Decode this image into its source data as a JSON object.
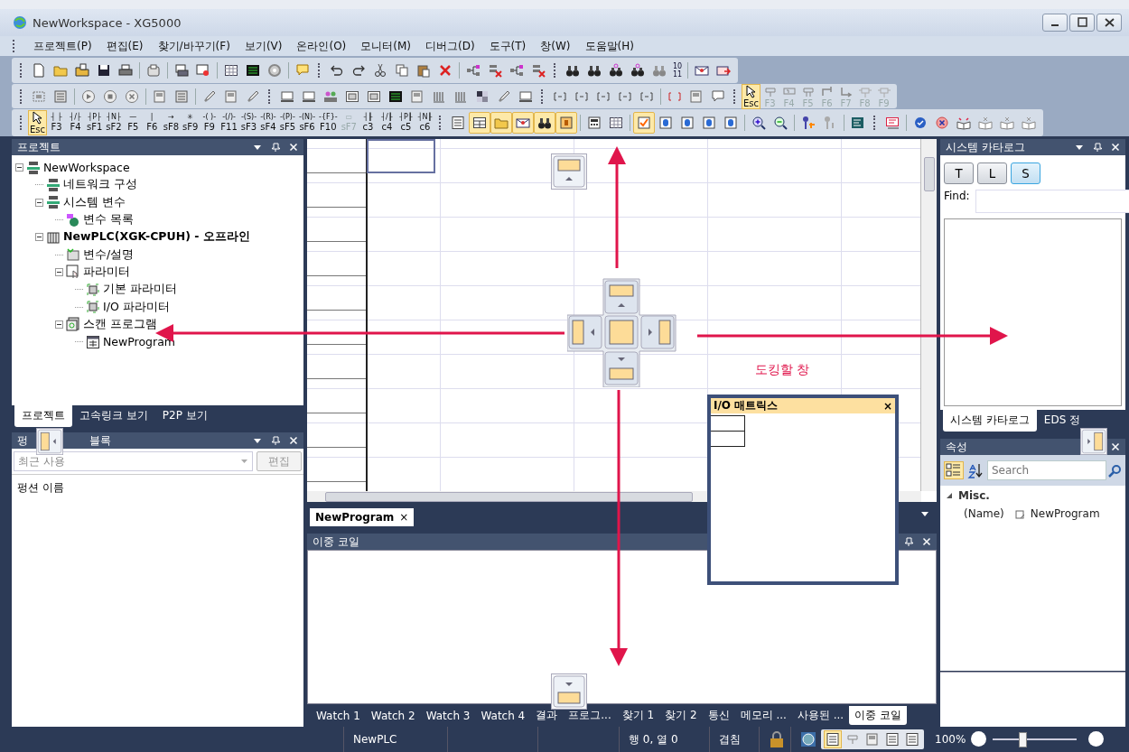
{
  "window": {
    "title": "NewWorkspace - XG5000"
  },
  "menu": [
    "프로젝트(P)",
    "편집(E)",
    "찾기/바꾸기(F)",
    "보기(V)",
    "온라인(O)",
    "모니터(M)",
    "디버그(D)",
    "도구(T)",
    "창(W)",
    "도움말(H)"
  ],
  "toolbar": {
    "replace_numbers": [
      "10",
      "11"
    ],
    "ladder_tools": [
      {
        "key": "Esc",
        "selected": true,
        "disabled": false
      },
      {
        "key": "F3",
        "selected": false,
        "disabled": true
      },
      {
        "key": "F4",
        "selected": false,
        "disabled": true
      },
      {
        "key": "F5",
        "selected": false,
        "disabled": true
      },
      {
        "key": "F6",
        "selected": false,
        "disabled": true
      },
      {
        "key": "F7",
        "selected": false,
        "disabled": true
      },
      {
        "key": "F8",
        "selected": false,
        "disabled": true
      },
      {
        "key": "F9",
        "selected": false,
        "disabled": true
      }
    ],
    "ladder_keys": [
      {
        "key": "Esc",
        "selected": true,
        "disabled": false
      },
      {
        "symbol": "┤ ├",
        "key": "F3",
        "selected": false,
        "disabled": false
      },
      {
        "symbol": "┤/├",
        "key": "F4",
        "selected": false,
        "disabled": false
      },
      {
        "symbol": "┤P├",
        "key": "sF1",
        "selected": false,
        "disabled": false
      },
      {
        "symbol": "┤N├",
        "key": "sF2",
        "selected": false,
        "disabled": false
      },
      {
        "symbol": "—",
        "key": "F5",
        "selected": false,
        "disabled": false
      },
      {
        "symbol": "|",
        "key": "F6",
        "selected": false,
        "disabled": false
      },
      {
        "symbol": "→",
        "key": "sF8",
        "selected": false,
        "disabled": false
      },
      {
        "symbol": "✳",
        "key": "sF9",
        "selected": false,
        "disabled": false
      },
      {
        "symbol": "-( )-",
        "key": "F9",
        "selected": false,
        "disabled": false
      },
      {
        "symbol": "-(/)-",
        "key": "F11",
        "selected": false,
        "disabled": false
      },
      {
        "symbol": "-(S)-",
        "key": "sF3",
        "selected": false,
        "disabled": false
      },
      {
        "symbol": "-(R)-",
        "key": "sF4",
        "selected": false,
        "disabled": false
      },
      {
        "symbol": "-(P)-",
        "key": "sF5",
        "selected": false,
        "disabled": false
      },
      {
        "symbol": "-(N)-",
        "key": "sF6",
        "selected": false,
        "disabled": false
      },
      {
        "symbol": "-{F}-",
        "key": "F10",
        "selected": false,
        "disabled": false
      },
      {
        "symbol": "▭",
        "key": "sF7",
        "selected": false,
        "disabled": true
      },
      {
        "symbol": "┤┠",
        "key": "c3",
        "selected": false,
        "disabled": false
      },
      {
        "symbol": "┤/┠",
        "key": "c4",
        "selected": false,
        "disabled": false
      },
      {
        "symbol": "┤P┠",
        "key": "c5",
        "selected": false,
        "disabled": false
      },
      {
        "symbol": "┤N┠",
        "key": "c6",
        "selected": false,
        "disabled": false
      }
    ],
    "view_tools": [
      {
        "selected": false
      },
      {
        "selected": true
      },
      {
        "selected": true
      },
      {
        "selected": true
      },
      {
        "selected": true
      },
      {
        "selected": true
      },
      {
        "selected": false
      },
      {
        "selected": false
      },
      {
        "selected": true
      },
      {
        "selected": false
      },
      {
        "selected": false
      },
      {
        "selected": false
      },
      {
        "selected": false
      }
    ]
  },
  "project_panel": {
    "title": "프로젝트",
    "tree": [
      {
        "label": "NewWorkspace",
        "kind": "workspace",
        "expanded": true,
        "children": [
          {
            "label": "네트워크 구성",
            "kind": "network"
          },
          {
            "label": "시스템 변수",
            "kind": "network",
            "expanded": true,
            "children": [
              {
                "label": "변수 목록",
                "kind": "globe"
              }
            ]
          },
          {
            "label": "NewPLC(XGK-CPUH) - 오프라인",
            "kind": "plc",
            "expanded": true,
            "children": [
              {
                "label": "변수/설명",
                "kind": "vars"
              },
              {
                "label": "파라미터",
                "kind": "param",
                "expanded": true,
                "children": [
                  {
                    "label": "기본 파라미터",
                    "kind": "module"
                  },
                  {
                    "label": "I/O 파라미터",
                    "kind": "module"
                  }
                ]
              },
              {
                "label": "스캔 프로그램",
                "kind": "scan",
                "expanded": true,
                "children": [
                  {
                    "label": "NewProgram",
                    "kind": "program"
                  }
                ]
              }
            ]
          }
        ]
      }
    ],
    "tabs": [
      {
        "label": "프로젝트",
        "selected": true
      },
      {
        "label": "고속링크 보기",
        "selected": false
      },
      {
        "label": "P2P 보기",
        "selected": false
      }
    ]
  },
  "function_panel": {
    "title_parts": [
      "펑",
      "블록"
    ],
    "filter": {
      "value": "최근 사용",
      "disabled": true
    },
    "edit_button": {
      "label": "편집",
      "disabled": true
    },
    "list_header": "펑션 이름"
  },
  "editor": {
    "tab": {
      "label": "NewProgram",
      "close": "×"
    }
  },
  "output_panel": {
    "title": "이중 코일",
    "tabs": [
      {
        "label": "Watch 1",
        "selected": false
      },
      {
        "label": "Watch 2",
        "selected": false
      },
      {
        "label": "Watch 3",
        "selected": false
      },
      {
        "label": "Watch 4",
        "selected": false
      },
      {
        "label": "결과",
        "selected": false
      },
      {
        "label": "프로그...",
        "selected": false
      },
      {
        "label": "찾기 1",
        "selected": false
      },
      {
        "label": "찾기 2",
        "selected": false
      },
      {
        "label": "통신",
        "selected": false
      },
      {
        "label": "메모리 ...",
        "selected": false
      },
      {
        "label": "사용된 ...",
        "selected": false
      },
      {
        "label": "이중 코일",
        "selected": true
      }
    ]
  },
  "catalog_panel": {
    "title": "시스템 카타로그",
    "filters": [
      {
        "label": "T",
        "selected": false
      },
      {
        "label": "L",
        "selected": false
      },
      {
        "label": "S",
        "selected": true
      }
    ],
    "find_label": "Find:",
    "tabs": [
      {
        "label": "시스템 카타로그",
        "selected": true
      },
      {
        "label": "EDS 정",
        "selected": false
      }
    ]
  },
  "properties_panel": {
    "title": "속성",
    "search": {
      "placeholder": "Search"
    },
    "category": "Misc.",
    "rows": [
      {
        "name": "(Name)",
        "value": "NewProgram"
      }
    ]
  },
  "status_bar": {
    "plc": "NewPLC",
    "position": "행 0, 열 0",
    "mode": "겹침",
    "view_modes": [
      {
        "selected": true
      },
      {
        "selected": false
      },
      {
        "selected": false
      },
      {
        "selected": false
      },
      {
        "selected": false
      }
    ],
    "zoom": "100%",
    "zoom_slider": {
      "level": 0.35
    }
  },
  "docking": {
    "hint": "도킹할 창",
    "floating_window": {
      "title": "I/O 매트릭스",
      "close": "×"
    }
  }
}
